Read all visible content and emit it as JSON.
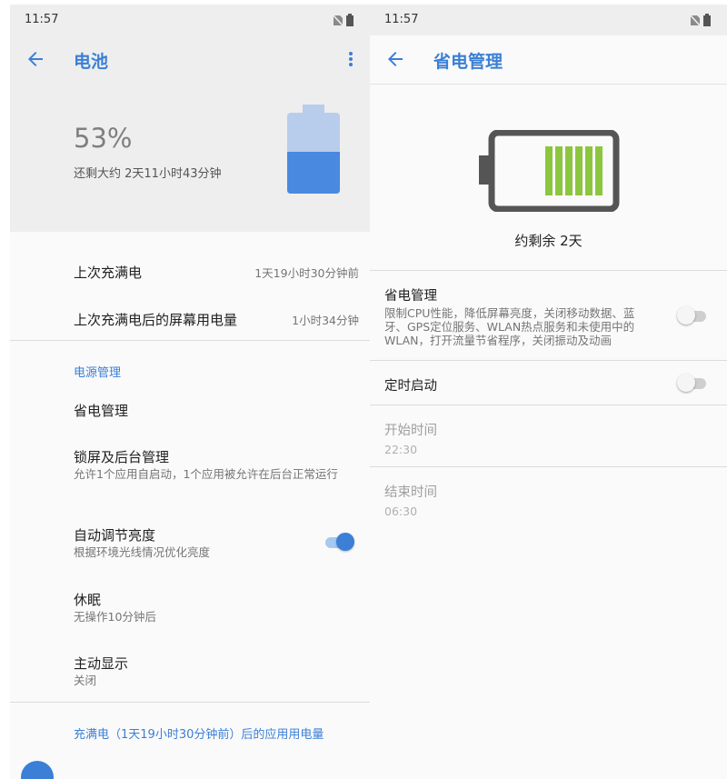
{
  "left": {
    "status_time": "11:57",
    "title": "电池",
    "battery_percent": "53%",
    "battery_level": 0.53,
    "remaining": "还剩大约 2天11小时43分钟",
    "last_full_charge": {
      "label": "上次充满电",
      "value": "1天19小时30分钟前"
    },
    "screen_usage": {
      "label": "上次充满电后的屏幕用电量",
      "value": "1小时34分钟"
    },
    "section_power": "电源管理",
    "power_saving": {
      "title": "省电管理"
    },
    "lock_screen": {
      "title": "锁屏及后台管理",
      "subtitle": "允许1个应用自启动，1个应用被允许在后台正常运行"
    },
    "auto_brightness": {
      "title": "自动调节亮度",
      "subtitle": "根据环境光线情况优化亮度",
      "enabled": true
    },
    "sleep": {
      "title": "休眠",
      "subtitle": "无操作10分钟后"
    },
    "ambient_display": {
      "title": "主动显示",
      "subtitle": "关闭"
    },
    "section_usage": "充满电（1天19小时30分钟前）后的应用用电量"
  },
  "right": {
    "status_time": "11:57",
    "title": "省电管理",
    "remaining": "约剩余 2天",
    "power_saving": {
      "title": "省电管理",
      "description": "限制CPU性能，降低屏幕亮度，关闭移动数据、蓝牙、GPS定位服务、WLAN热点服务和未使用中的WLAN，打开流量节省程序，关闭振动及动画",
      "enabled": false
    },
    "scheduled": {
      "title": "定时启动",
      "enabled": false
    },
    "start_time": {
      "title": "开始时间",
      "value": "22:30"
    },
    "end_time": {
      "title": "结束时间",
      "value": "06:30"
    }
  },
  "colors": {
    "accent": "#3b7fd6",
    "battery_fill": "#4a89e0",
    "battery_empty": "#b8cdeb",
    "big_battery_cells": "#8cc63f",
    "big_battery_frame": "#555555"
  },
  "icons": [
    "no-sim-icon",
    "battery-status-icon",
    "back-arrow-icon",
    "more-vert-icon",
    "battery-icon"
  ]
}
